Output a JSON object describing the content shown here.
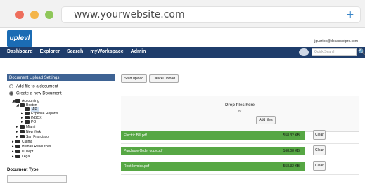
{
  "browser": {
    "url": "www.yourwebsite.com",
    "plus_icon": "plus-icon"
  },
  "app": {
    "logo_text": "uplevl",
    "user_email": "jguarino@docassistpro.com",
    "nav": [
      "Dashboard",
      "Explorer",
      "Search",
      "myWorkspace",
      "Admin"
    ],
    "quick_search_placeholder": "Quick Search"
  },
  "left_panel": {
    "title": "Document Upload Settings",
    "options": [
      {
        "label": "Add file to a document",
        "selected": false
      },
      {
        "label": "Create a new Document",
        "selected": true
      }
    ],
    "tree": [
      {
        "label": "Accounting",
        "level": 0
      },
      {
        "label": "Boston",
        "level": 1
      },
      {
        "label": "AP",
        "level": 2,
        "selected": true
      },
      {
        "label": "Expense Reports",
        "level": 2
      },
      {
        "label": "INBOX",
        "level": 2
      },
      {
        "label": "PO",
        "level": 2
      },
      {
        "label": "Miami",
        "level": 1
      },
      {
        "label": "New York",
        "level": 1
      },
      {
        "label": "San Francisco",
        "level": 1
      },
      {
        "label": "Claims",
        "level": 0
      },
      {
        "label": "Human Resources",
        "level": 0
      },
      {
        "label": "IT Dept",
        "level": 0
      },
      {
        "label": "Legal",
        "level": 0
      }
    ],
    "document_type_label": "Document Type:"
  },
  "right_panel": {
    "start_upload": "Start upload",
    "cancel_upload": "Cancel upload",
    "drop_title": "Drop files here",
    "drop_or": "or",
    "add_files": "Add files",
    "files": [
      {
        "name": "Electric Bill.pdf",
        "size": "558.32 KB",
        "clear": "Clear"
      },
      {
        "name": "Purchase Order copy.pdf",
        "size": "168.08 KB",
        "clear": "Clear"
      },
      {
        "name": "Rent Invoice.pdf",
        "size": "558.32 KB",
        "clear": "Clear"
      }
    ]
  },
  "colors": {
    "nav_bg": "#1f3d6b",
    "panel_header": "#3e6394",
    "progress_green": "#56a744",
    "logo_blue": "#1b6cb4"
  }
}
